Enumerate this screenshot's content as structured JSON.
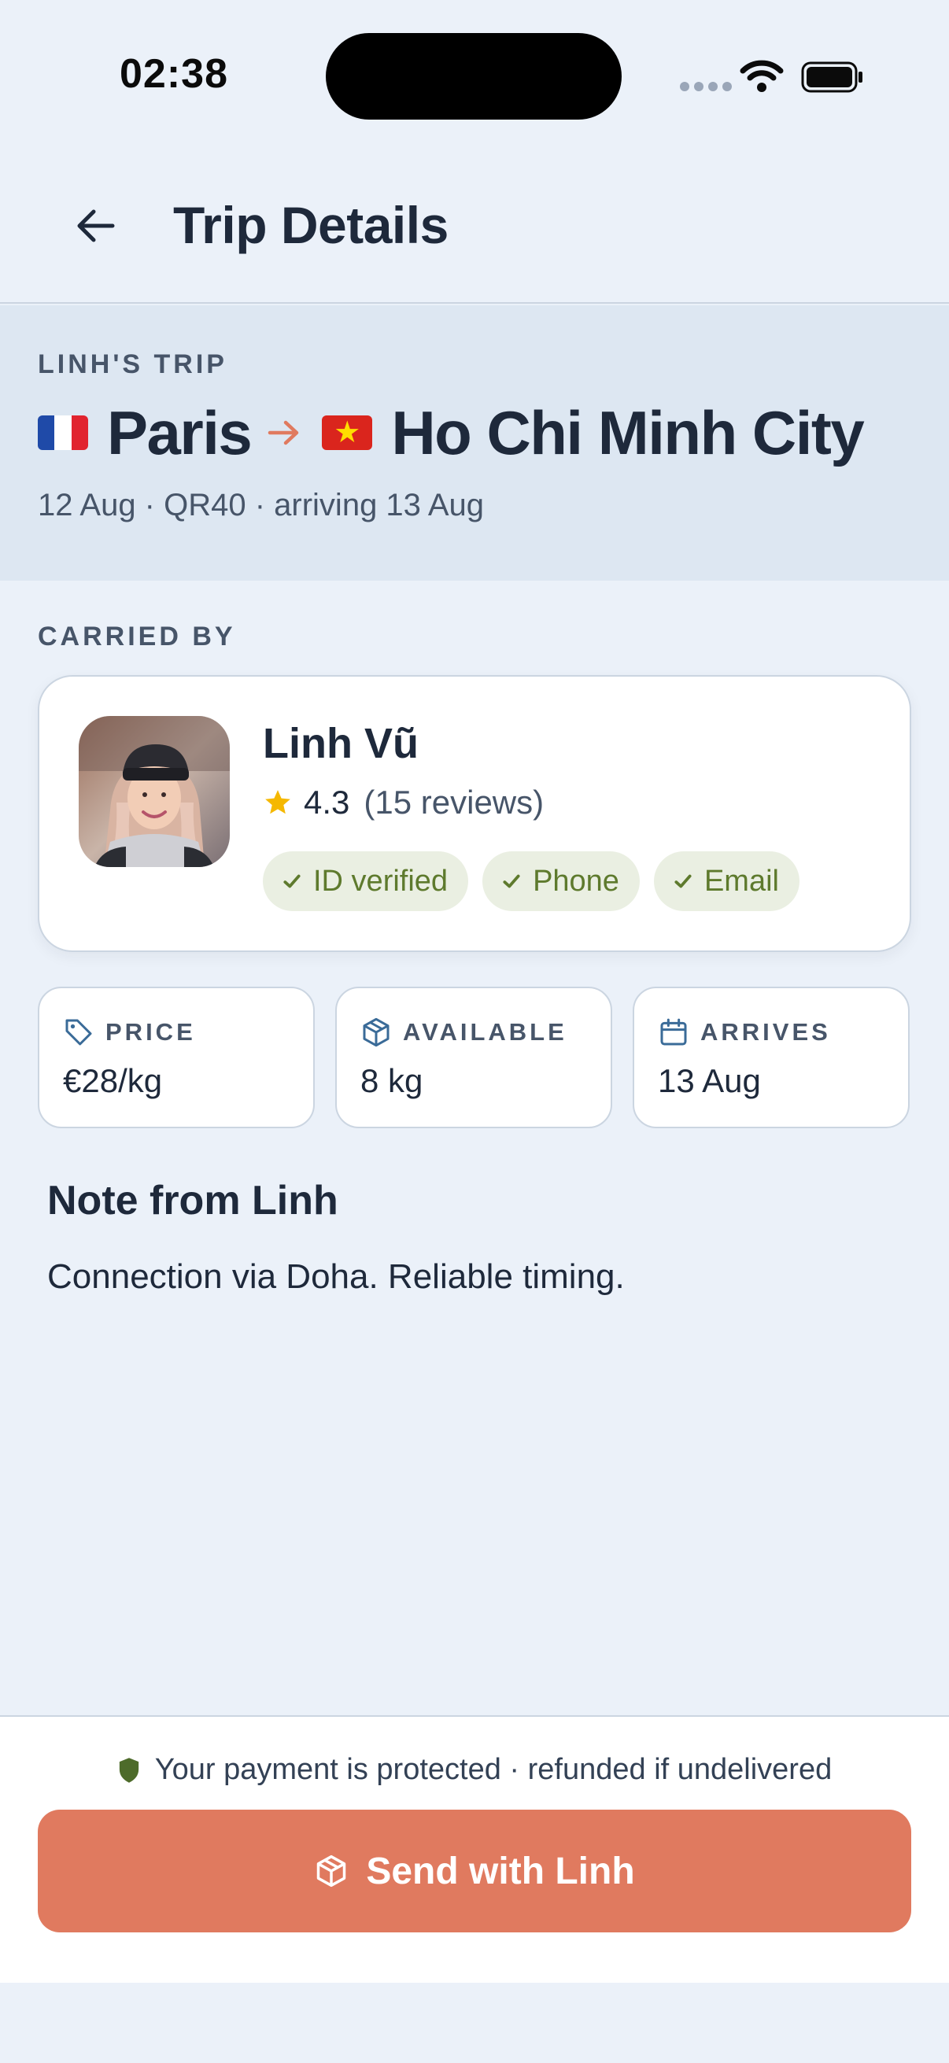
{
  "status_bar": {
    "time": "02:38"
  },
  "header": {
    "title": "Trip Details"
  },
  "trip": {
    "owner_label": "LINH'S TRIP",
    "origin": {
      "city": "Paris",
      "flag": "france-flag"
    },
    "destination": {
      "city": "Ho Chi Minh City",
      "flag": "vietnam-flag"
    },
    "meta": "12 Aug · QR40 · arriving 13 Aug"
  },
  "carrier": {
    "section_label": "CARRIED BY",
    "name": "Linh Vũ",
    "rating": "4.3",
    "reviews": "(15 reviews)",
    "badges": [
      "ID verified",
      "Phone",
      "Email"
    ]
  },
  "stats": [
    {
      "label": "PRICE",
      "value": "€28/kg",
      "icon": "tag-icon"
    },
    {
      "label": "AVAILABLE",
      "value": "8 kg",
      "icon": "package-icon"
    },
    {
      "label": "ARRIVES",
      "value": "13 Aug",
      "icon": "calendar-icon"
    }
  ],
  "note": {
    "title": "Note from Linh",
    "text": "Connection via Doha. Reliable timing."
  },
  "footer": {
    "protection_text": "Your payment is protected · refunded if undelivered",
    "send_button_label": "Send with Linh"
  },
  "colors": {
    "accent": "#e07a5f",
    "background": "#ebf1f9",
    "badge_bg": "#eaefe2",
    "badge_text": "#5e7a2d",
    "shield": "#4d6b2a",
    "star": "#f5b800",
    "icon_blue": "#3a6b98"
  }
}
